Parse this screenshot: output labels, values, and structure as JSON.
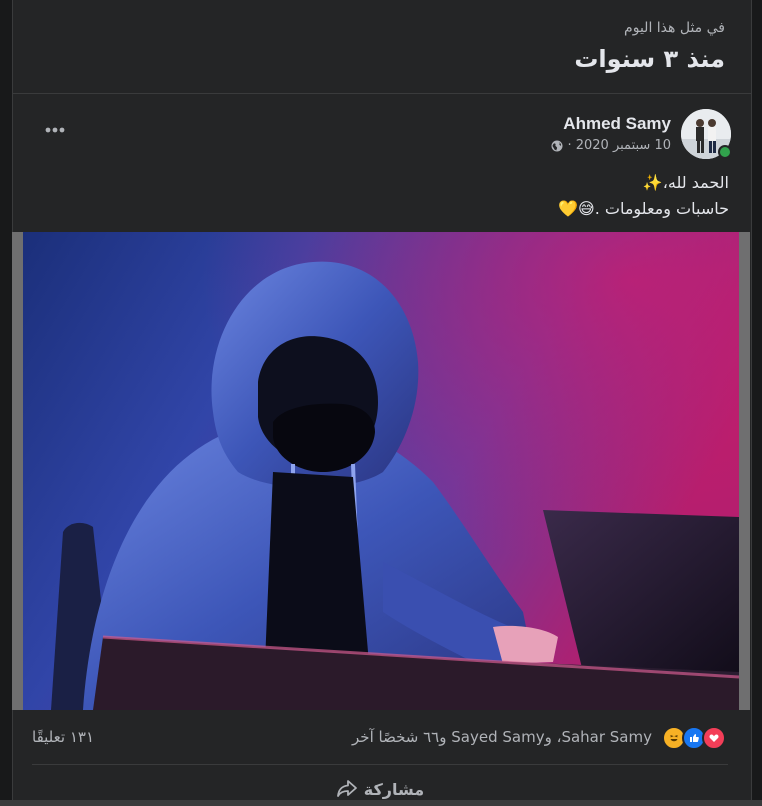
{
  "memory": {
    "subtitle": "في مثل هذا اليوم",
    "title": "منذ ٣ سنوات"
  },
  "post": {
    "author": "Ahmed Samy",
    "date": "10 سبتمبر 2020 ·",
    "privacy_icon": "globe-icon",
    "more_icon": "more-options-icon",
    "text_line1": "الحمد لله،✨",
    "text_line2": "حاسبات ومعلومات .😅💛",
    "photo_icon": "hooded-hacker-photo"
  },
  "reactions": {
    "icons": [
      "love-icon",
      "like-icon",
      "haha-icon"
    ],
    "summary": "Sahar Samy، وSayed Samy و٦٦ شخصًا آخر",
    "comments": "١٣١ تعليقًا"
  },
  "actions": {
    "share_label": "مشاركة",
    "share_icon": "share-arrow-icon"
  },
  "colors": {
    "background": "#242526",
    "text_primary": "#e4e6eb",
    "text_secondary": "#b0b3b8",
    "online": "#31a24c",
    "like_blue": "#1877f2",
    "love_red": "#f33e58",
    "haha_yellow": "#f7b125"
  }
}
